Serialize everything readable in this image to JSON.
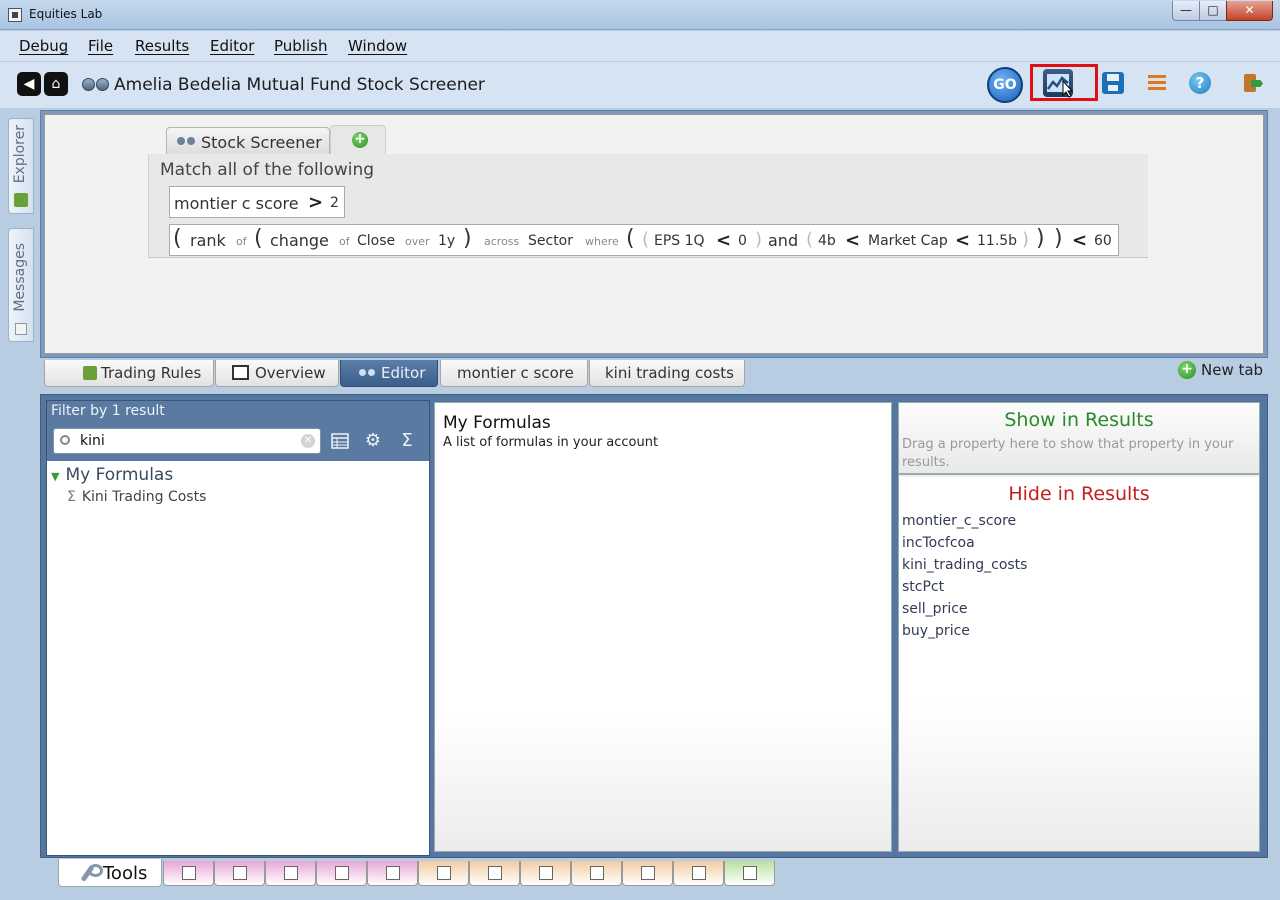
{
  "window": {
    "title": "Equities Lab",
    "controls": {
      "minimize": "—",
      "maximize": "□",
      "close": "✕"
    }
  },
  "menu": [
    "Debug",
    "File",
    "Results",
    "Editor",
    "Publish",
    "Window"
  ],
  "toolbar": {
    "doc_title": "Amelia Bedelia Mutual Fund Stock Screener",
    "go_label": "GO",
    "help_label": "?",
    "back_glyph": "◀",
    "home_glyph": "⌂"
  },
  "side_tabs": [
    "Explorer",
    "Messages"
  ],
  "editor": {
    "tab_label": "Stock Screener",
    "match_text": "Match all of the following",
    "rule1": {
      "field": "montier c score",
      "op": ">",
      "value": "2"
    },
    "rule2": {
      "rank": "rank",
      "of1": "of",
      "change": "change",
      "of2": "of",
      "close": "Close",
      "over": "over",
      "period": "1y",
      "across": "across",
      "sector": "Sector",
      "where": "where",
      "eps": "EPS 1Q",
      "lt1": "<",
      "zero": "0",
      "and": "and",
      "lo": "4b",
      "lt2": "<",
      "mcap": "Market Cap",
      "lt3": "<",
      "hi": "11.5b",
      "lt4": "<",
      "limit": "60"
    }
  },
  "lower_tabs": [
    "Trading Rules",
    "Overview",
    "Editor",
    "montier c score",
    "kini trading costs"
  ],
  "new_tab_label": "New tab",
  "filter": {
    "header": "Filter by 1 result",
    "search_value": "kini",
    "sigma_glyph": "Σ",
    "gear_glyph": "⚙",
    "root": "My Formulas",
    "leaf_glyph": "Σ",
    "leaf": "Kini Trading Costs"
  },
  "formulas_panel": {
    "title": "My Formulas",
    "subtitle": "A list of formulas in your account"
  },
  "results": {
    "show_title": "Show in Results",
    "show_hint": "Drag a property here to show that property in your results.",
    "hide_title": "Hide in Results",
    "hidden_props": [
      "montier_c_score",
      "incTocfcoa",
      "kini_trading_costs",
      "stcPct",
      "sell_price",
      "buy_price"
    ]
  },
  "bottom": {
    "tools_label": "Tools",
    "tool_tab_colors": [
      "#e7a6d6",
      "#e7a6d6",
      "#e7a6d6",
      "#e7a6d6",
      "#e7a6d6",
      "#f1cda0",
      "#f1cda0",
      "#f1cda0",
      "#f1cda0",
      "#f1cda0",
      "#f1cda0",
      "#b9e0a0"
    ]
  },
  "colors": {
    "accent": "#3b5e8a",
    "show": "#2a8a2a",
    "hide": "#c41e1e",
    "highlight": "#e01010"
  }
}
